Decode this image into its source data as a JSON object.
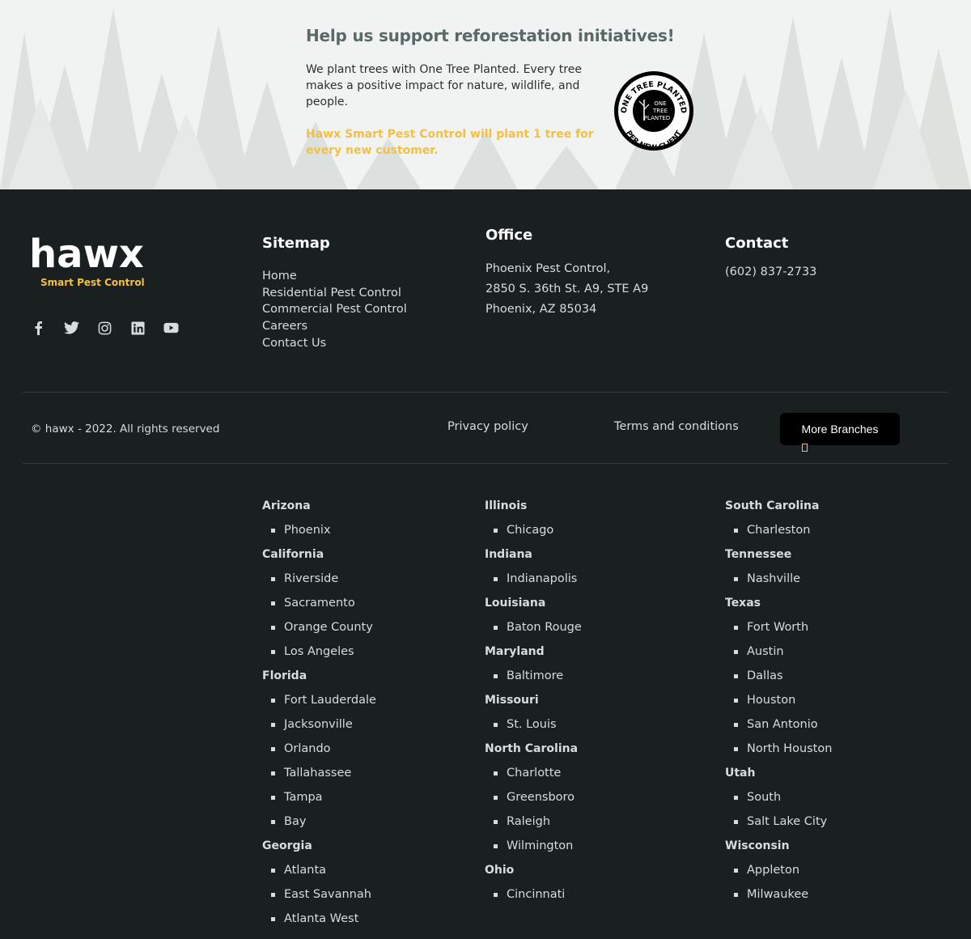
{
  "banner": {
    "title": "Help us support reforestation initiatives!",
    "text": "We plant trees with One Tree Planted. Every tree makes a positive impact for nature, wildlife, and people.",
    "highlight": "Hawx Smart Pest Control will plant 1 tree for every new customer.",
    "badge_outer": "ONE TREE PLANTED",
    "badge_inner": "PER NEW CLIENT",
    "badge_center": [
      "ONE",
      "TREE",
      "PLANTED"
    ]
  },
  "brand": {
    "name": "hawx",
    "tagline": "Smart Pest Control",
    "accent": "#f2c046"
  },
  "social": [
    "facebook-icon",
    "twitter-icon",
    "instagram-icon",
    "linkedin-icon",
    "youtube-icon"
  ],
  "sitemap": {
    "title": "Sitemap",
    "links": [
      "Home",
      "Residential Pest Control",
      "Commercial Pest Control",
      "Careers",
      "Contact Us"
    ]
  },
  "office": {
    "title": "Office",
    "lines": [
      "Phoenix Pest Control,",
      "2850 S. 36th St. A9, STE A9",
      "Phoenix, AZ 85034"
    ]
  },
  "contact": {
    "title": "Contact",
    "phone": "(602) 837-2733"
  },
  "bottom": {
    "copyright": "© hawx - 2022. All rights reserved",
    "privacy": "Privacy policy",
    "terms": "Terms and conditions",
    "branches_button": "More Branches"
  },
  "branches": [
    [
      {
        "state": "Arizona",
        "cities": [
          "Phoenix"
        ]
      },
      {
        "state": "California",
        "cities": [
          "Riverside",
          "Sacramento",
          "Orange County",
          "Los Angeles"
        ]
      },
      {
        "state": "Florida",
        "cities": [
          "Fort Lauderdale",
          "Jacksonville",
          "Orlando",
          "Tallahassee",
          "Tampa",
          "Bay"
        ]
      },
      {
        "state": "Georgia",
        "cities": [
          "Atlanta",
          "East Savannah",
          "Atlanta West"
        ]
      }
    ],
    [
      {
        "state": "Illinois",
        "cities": [
          "Chicago"
        ]
      },
      {
        "state": "Indiana",
        "cities": [
          "Indianapolis"
        ]
      },
      {
        "state": "Louisiana",
        "cities": [
          "Baton Rouge"
        ]
      },
      {
        "state": "Maryland",
        "cities": [
          "Baltimore"
        ]
      },
      {
        "state": "Missouri",
        "cities": [
          "St. Louis"
        ]
      },
      {
        "state": "North Carolina",
        "cities": [
          "Charlotte",
          "Greensboro",
          "Raleigh",
          "Wilmington"
        ]
      },
      {
        "state": "Ohio",
        "cities": [
          "Cincinnati"
        ]
      }
    ],
    [
      {
        "state": "South Carolina",
        "cities": [
          "Charleston"
        ]
      },
      {
        "state": "Tennessee",
        "cities": [
          "Nashville"
        ]
      },
      {
        "state": "Texas",
        "cities": [
          "Fort Worth",
          "Austin",
          "Dallas",
          "Houston",
          "San Antonio",
          "North Houston"
        ]
      },
      {
        "state": "Utah",
        "cities": [
          "South",
          "Salt Lake City"
        ]
      },
      {
        "state": "Wisconsin",
        "cities": [
          "Appleton",
          "Milwaukee"
        ]
      }
    ]
  ]
}
